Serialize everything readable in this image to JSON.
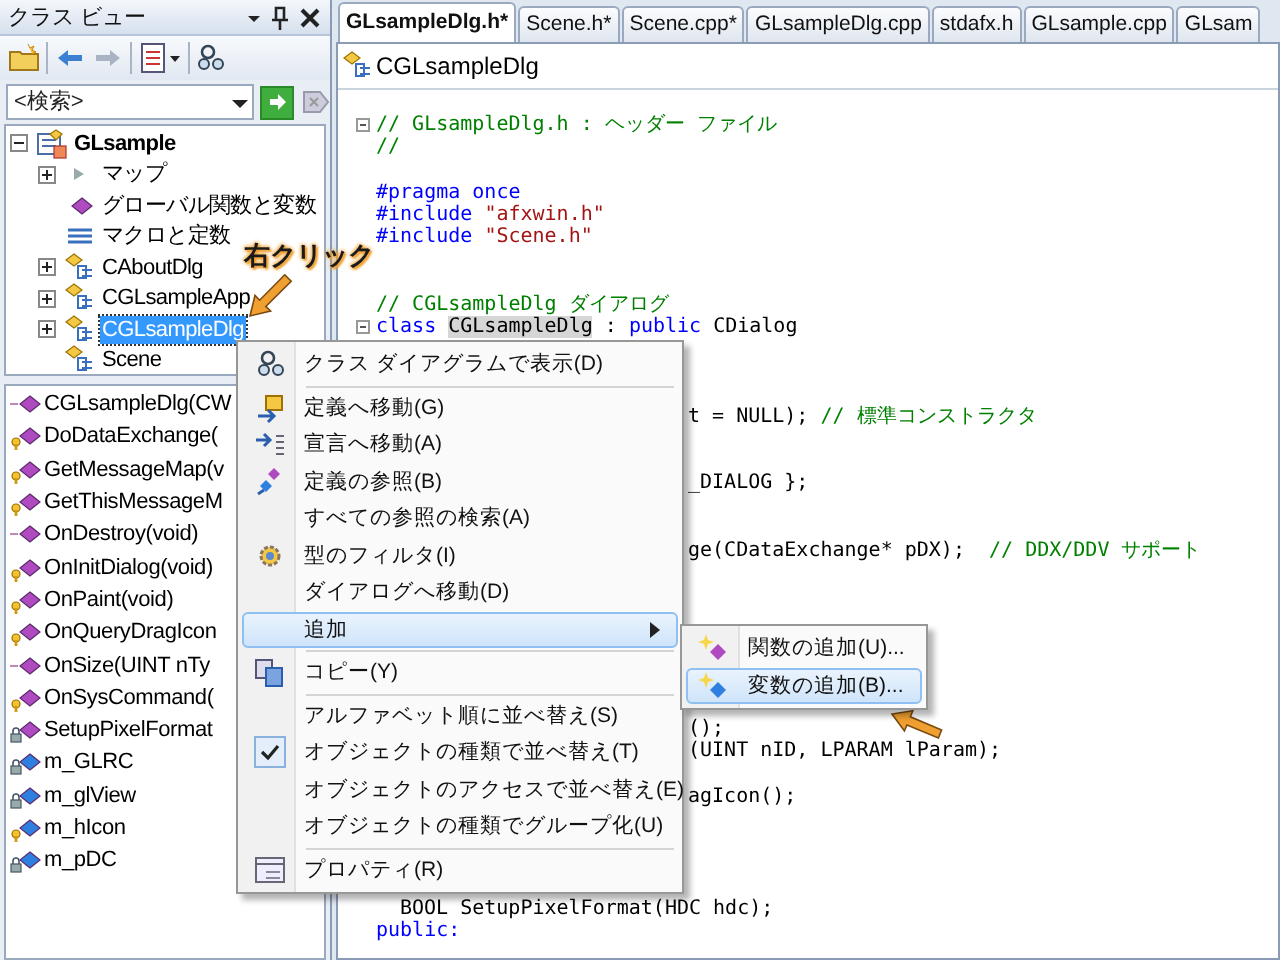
{
  "left_panel": {
    "title": "クラス ビュー",
    "search": {
      "placeholder": "<検索>"
    },
    "class_tree": [
      {
        "label": "GLsample",
        "kind": "project",
        "expanded": true,
        "selected": false,
        "children": [
          {
            "label": "マップ",
            "kind": "map",
            "expanded": false,
            "selected": false
          },
          {
            "label": "グローバル関数と変数",
            "kind": "globals",
            "selected": false
          },
          {
            "label": "マクロと定数",
            "kind": "macros",
            "selected": false
          },
          {
            "label": "CAboutDlg",
            "kind": "class",
            "expanded": false,
            "selected": false
          },
          {
            "label": "CGLsampleApp",
            "kind": "class",
            "expanded": false,
            "selected": false
          },
          {
            "label": "CGLsampleDlg",
            "kind": "class",
            "expanded": false,
            "selected": true
          },
          {
            "label": "Scene",
            "kind": "class",
            "selected": false
          }
        ]
      }
    ],
    "members": [
      {
        "label": "CGLsampleDlg(CW",
        "kind": "public-method"
      },
      {
        "label": "DoDataExchange(",
        "kind": "protected-method"
      },
      {
        "label": "GetMessageMap(v",
        "kind": "protected-method"
      },
      {
        "label": "GetThisMessageM",
        "kind": "protected-method"
      },
      {
        "label": "OnDestroy(void)",
        "kind": "public-method"
      },
      {
        "label": "OnInitDialog(void)",
        "kind": "protected-method"
      },
      {
        "label": "OnPaint(void)",
        "kind": "protected-method"
      },
      {
        "label": "OnQueryDragIcon",
        "kind": "protected-method"
      },
      {
        "label": "OnSize(UINT nTy",
        "kind": "public-method"
      },
      {
        "label": "OnSysCommand(",
        "kind": "protected-method"
      },
      {
        "label": "SetupPixelFormat",
        "kind": "private-method"
      },
      {
        "label": "m_GLRC",
        "kind": "private-field"
      },
      {
        "label": "m_glView",
        "kind": "private-field"
      },
      {
        "label": "m_hIcon",
        "kind": "protected-field"
      },
      {
        "label": "m_pDC",
        "kind": "private-field"
      }
    ]
  },
  "editor": {
    "tabs": [
      {
        "label": "GLsampleDlg.h*",
        "selected": true
      },
      {
        "label": "Scene.h*",
        "selected": false
      },
      {
        "label": "Scene.cpp*",
        "selected": false
      },
      {
        "label": "GLsampleDlg.cpp",
        "selected": false
      },
      {
        "label": "stdafx.h",
        "selected": false
      },
      {
        "label": "GLsample.cpp",
        "selected": false
      },
      {
        "label": "GLsam",
        "selected": false
      }
    ],
    "class_selector": "CGLsampleDlg",
    "lines": [
      {
        "kind": "fold-start",
        "tokens": [
          {
            "kind": "comment",
            "text": "// GLsampleDlg.h : ヘッダー ファイル"
          }
        ]
      },
      {
        "kind": "code",
        "tokens": [
          {
            "kind": "comment",
            "text": "//"
          }
        ]
      },
      {
        "kind": "blank"
      },
      {
        "kind": "code",
        "tokens": [
          {
            "kind": "keyword",
            "text": "#pragma once"
          }
        ]
      },
      {
        "kind": "code",
        "tokens": [
          {
            "kind": "keyword",
            "text": "#include "
          },
          {
            "kind": "string",
            "text": "\"afxwin.h\""
          }
        ]
      },
      {
        "kind": "code",
        "tokens": [
          {
            "kind": "keyword",
            "text": "#include "
          },
          {
            "kind": "string",
            "text": "\"Scene.h\""
          }
        ]
      },
      {
        "kind": "blank"
      },
      {
        "kind": "blank"
      },
      {
        "kind": "code",
        "tokens": [
          {
            "kind": "comment",
            "text": "// CGLsampleDlg ダイアログ"
          }
        ]
      },
      {
        "kind": "fold-start",
        "tokens": [
          {
            "kind": "keyword",
            "text": "class "
          },
          {
            "kind": "highlight",
            "text": "CGLsampleDlg"
          },
          {
            "kind": "plain",
            "text": " : "
          },
          {
            "kind": "keyword",
            "text": "public"
          },
          {
            "kind": "plain",
            "text": " CDialog"
          }
        ]
      },
      {
        "kind": "blank"
      },
      {
        "kind": "blank"
      },
      {
        "kind": "blank"
      },
      {
        "kind": "tail",
        "tokens": [
          {
            "kind": "plain",
            "text": "t = NULL); "
          },
          {
            "kind": "comment",
            "text": "// 標準コンストラクタ"
          }
        ]
      },
      {
        "kind": "blank"
      },
      {
        "kind": "blank"
      },
      {
        "kind": "tail",
        "tokens": [
          {
            "kind": "plain",
            "text": "_DIALOG };"
          }
        ]
      },
      {
        "kind": "blank"
      },
      {
        "kind": "blank"
      },
      {
        "kind": "tail",
        "tokens": [
          {
            "kind": "plain",
            "text": "ge(CDataExchange* pDX);  "
          },
          {
            "kind": "comment",
            "text": "// DDX/DDV サポート"
          }
        ]
      },
      {
        "kind": "blank"
      },
      {
        "kind": "blank"
      },
      {
        "kind": "blank"
      },
      {
        "kind": "blank"
      },
      {
        "kind": "blank"
      },
      {
        "kind": "blank"
      },
      {
        "kind": "blank"
      },
      {
        "kind": "tail",
        "tokens": [
          {
            "kind": "plain",
            "text": "();"
          }
        ]
      },
      {
        "kind": "tail",
        "tokens": [
          {
            "kind": "plain",
            "text": "(UINT nID, LPARAM lParam);"
          }
        ]
      },
      {
        "kind": "blank"
      },
      {
        "kind": "tail",
        "tokens": [
          {
            "kind": "plain",
            "text": "agIcon();"
          }
        ]
      },
      {
        "kind": "blank"
      },
      {
        "kind": "blank"
      },
      {
        "kind": "blank"
      },
      {
        "kind": "blank"
      },
      {
        "kind": "indented",
        "tokens": [
          {
            "kind": "plain",
            "text": "BOOL SetupPixelFormat(HDC hdc);"
          }
        ]
      },
      {
        "kind": "code",
        "tokens": [
          {
            "kind": "keyword",
            "text": "public:"
          }
        ]
      }
    ]
  },
  "annotation": {
    "text": "右クリック"
  },
  "context_menu": {
    "items": [
      {
        "kind": "item",
        "label": "クラス ダイアグラムで表示(D)",
        "icon": true,
        "checked": false,
        "selected": false,
        "submenu": false
      },
      {
        "kind": "separator"
      },
      {
        "kind": "item",
        "label": "定義へ移動(G)",
        "icon": true,
        "checked": false,
        "selected": false,
        "submenu": false
      },
      {
        "kind": "item",
        "label": "宣言へ移動(A)",
        "icon": true,
        "checked": false,
        "selected": false,
        "submenu": false
      },
      {
        "kind": "item",
        "label": "定義の参照(B)",
        "icon": true,
        "checked": false,
        "selected": false,
        "submenu": false
      },
      {
        "kind": "item",
        "label": "すべての参照の検索(A)",
        "icon": false,
        "checked": false,
        "selected": false,
        "submenu": false
      },
      {
        "kind": "item",
        "label": "型のフィルタ(I)",
        "icon": true,
        "checked": false,
        "selected": false,
        "submenu": false
      },
      {
        "kind": "item",
        "label": "ダイアログへ移動(D)",
        "icon": false,
        "checked": false,
        "selected": false,
        "submenu": false
      },
      {
        "kind": "item",
        "label": "追加",
        "icon": false,
        "checked": false,
        "selected": true,
        "submenu": true
      },
      {
        "kind": "separator"
      },
      {
        "kind": "item",
        "label": "コピー(Y)",
        "icon": true,
        "checked": false,
        "selected": false,
        "submenu": false
      },
      {
        "kind": "separator"
      },
      {
        "kind": "item",
        "label": "アルファベット順に並べ替え(S)",
        "icon": false,
        "checked": false,
        "selected": false,
        "submenu": false
      },
      {
        "kind": "item",
        "label": "オブジェクトの種類で並べ替え(T)",
        "icon": false,
        "checked": true,
        "selected": false,
        "submenu": false
      },
      {
        "kind": "item",
        "label": "オブジェクトのアクセスで並べ替え(E)",
        "icon": false,
        "checked": false,
        "selected": false,
        "submenu": false
      },
      {
        "kind": "item",
        "label": "オブジェクトの種類でグループ化(U)",
        "icon": false,
        "checked": false,
        "selected": false,
        "submenu": false
      },
      {
        "kind": "separator"
      },
      {
        "kind": "item",
        "label": "プロパティ(R)",
        "icon": true,
        "checked": false,
        "selected": false,
        "submenu": false
      }
    ]
  },
  "submenu": {
    "items": [
      {
        "label": "関数の追加(U)...",
        "selected": false
      },
      {
        "label": "変数の追加(B)...",
        "selected": true
      }
    ]
  }
}
